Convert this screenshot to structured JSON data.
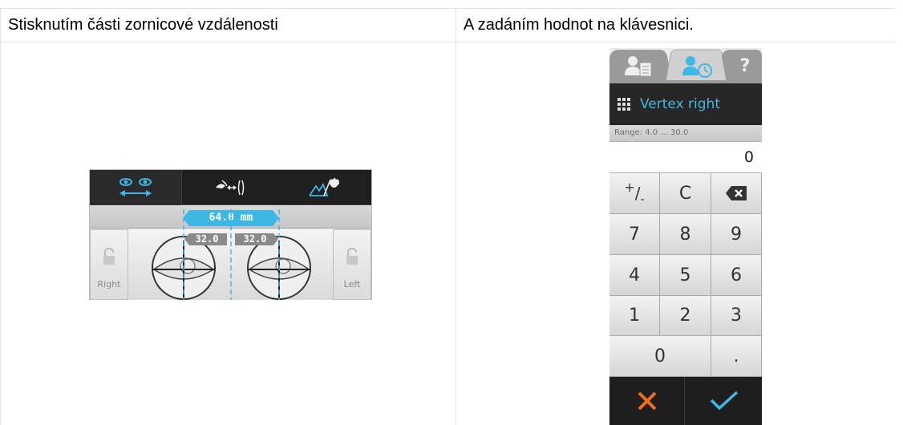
{
  "header": {
    "left": "Stisknutím části zornicové vzdálenosti",
    "right": "A zadáním hodnot na klávesnici."
  },
  "pd_widget": {
    "total_distance": "64.0 mm",
    "right_half": "32.0",
    "left_half": "32.0",
    "right_label": "Right",
    "left_label": "Left",
    "accent_color": "#3db8e5"
  },
  "keypad": {
    "title": "Vertex right",
    "range": "Range: 4.0 ... 30.0",
    "value": "0",
    "keys": {
      "plusminus_sup": "+",
      "plusminus_rest": "/ ",
      "plusminus_sub": "-",
      "clear": "C",
      "k7": "7",
      "k8": "8",
      "k9": "9",
      "k4": "4",
      "k5": "5",
      "k6": "6",
      "k1": "1",
      "k2": "2",
      "k3": "3",
      "k0": "0",
      "dot": "."
    },
    "help": "?",
    "cancel_color": "#f26c1f",
    "ok_color": "#3db8e5"
  }
}
